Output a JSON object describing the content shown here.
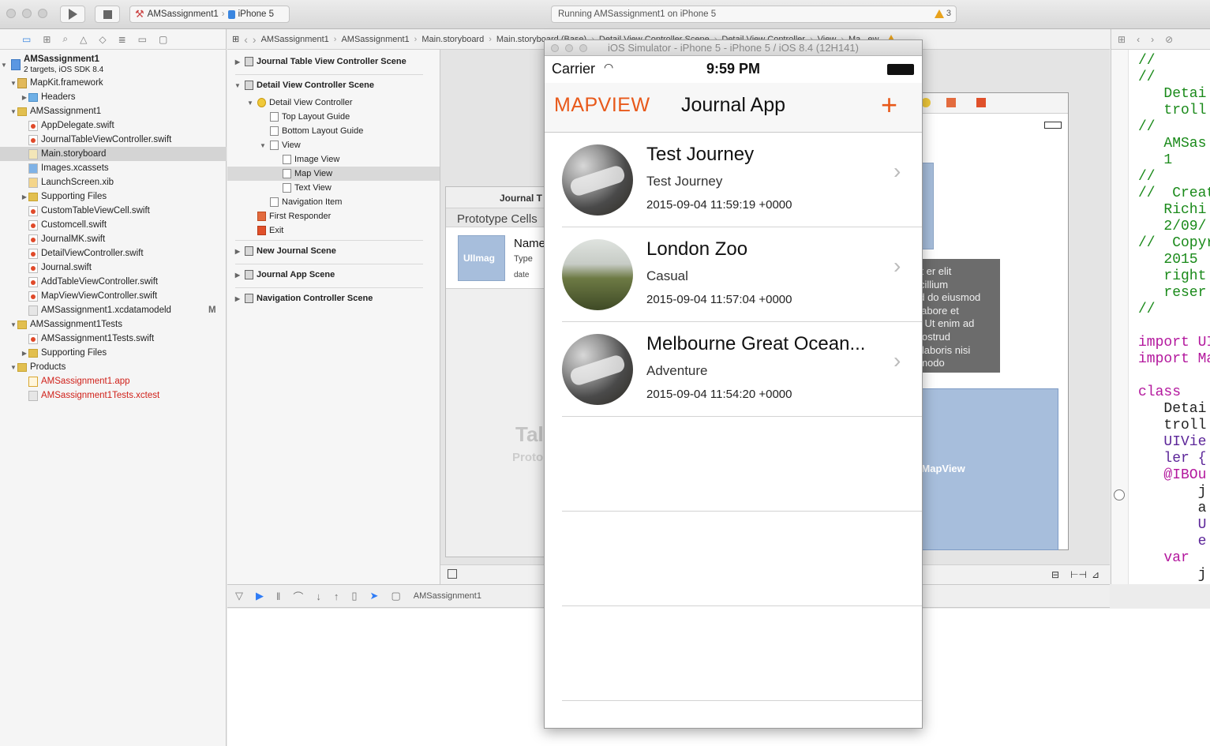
{
  "toolbar": {
    "scheme_app": "AMSassignment1",
    "scheme_device": "iPhone 5",
    "activity": "Running AMSassignment1 on iPhone 5",
    "warning_count": "3"
  },
  "navigator": {
    "project": {
      "name": "AMSassignment1",
      "subtitle": "2 targets, iOS SDK 8.4"
    },
    "items": [
      {
        "label": "MapKit.framework",
        "indent": 1,
        "type": "fw",
        "tri": "▼"
      },
      {
        "label": "Headers",
        "indent": 2,
        "type": "folderblue",
        "tri": "▶"
      },
      {
        "label": "AMSassignment1",
        "indent": 1,
        "type": "folder",
        "tri": "▼"
      },
      {
        "label": "AppDelegate.swift",
        "indent": 2,
        "type": "swift"
      },
      {
        "label": "JournalTableViewController.swift",
        "indent": 2,
        "type": "swift"
      },
      {
        "label": "Main.storyboard",
        "indent": 2,
        "type": "sb",
        "selected": true
      },
      {
        "label": "Images.xcassets",
        "indent": 2,
        "type": "xcassets"
      },
      {
        "label": "LaunchScreen.xib",
        "indent": 2,
        "type": "xib"
      },
      {
        "label": "Supporting Files",
        "indent": 2,
        "type": "folder",
        "tri": "▶"
      },
      {
        "label": "CustomTableViewCell.swift",
        "indent": 2,
        "type": "swift"
      },
      {
        "label": "Customcell.swift",
        "indent": 2,
        "type": "swift"
      },
      {
        "label": "JournalMK.swift",
        "indent": 2,
        "type": "swift"
      },
      {
        "label": "DetailViewController.swift",
        "indent": 2,
        "type": "swift"
      },
      {
        "label": "Journal.swift",
        "indent": 2,
        "type": "swift"
      },
      {
        "label": "AddTableViewController.swift",
        "indent": 2,
        "type": "swift"
      },
      {
        "label": "MapViewViewController.swift",
        "indent": 2,
        "type": "swift"
      },
      {
        "label": "AMSassignment1.xcdatamodeld",
        "indent": 2,
        "type": "model",
        "badge": "M"
      },
      {
        "label": "AMSassignment1Tests",
        "indent": 1,
        "type": "folder",
        "tri": "▼"
      },
      {
        "label": "AMSassignment1Tests.swift",
        "indent": 2,
        "type": "swift"
      },
      {
        "label": "Supporting Files",
        "indent": 2,
        "type": "folder",
        "tri": "▶"
      },
      {
        "label": "Products",
        "indent": 1,
        "type": "folder",
        "tri": "▼"
      },
      {
        "label": "AMSassignment1.app",
        "indent": 2,
        "type": "app",
        "red": true
      },
      {
        "label": "AMSassignment1Tests.xctest",
        "indent": 2,
        "type": "model",
        "red": true
      }
    ]
  },
  "jumpbar": {
    "items": [
      "AMSassignment1",
      "AMSassignment1",
      "Main.storyboard",
      "Main.storyboard (Base)",
      "Detail View Controller Scene",
      "Detail View Controller",
      "View",
      "Ma...ew"
    ]
  },
  "outline": {
    "rows": [
      {
        "label": "Journal Table View Controller Scene",
        "indent": 0,
        "tri": "▶",
        "bold": true,
        "icon": "scene"
      },
      {
        "label": "Detail View Controller Scene",
        "indent": 0,
        "tri": "▼",
        "bold": true,
        "icon": "scene"
      },
      {
        "label": "Detail View Controller",
        "indent": 1,
        "tri": "▼",
        "icon": "vc"
      },
      {
        "label": "Top Layout Guide",
        "indent": 2,
        "icon": "box"
      },
      {
        "label": "Bottom Layout Guide",
        "indent": 2,
        "icon": "box"
      },
      {
        "label": "View",
        "indent": 2,
        "tri": "▼",
        "icon": "box"
      },
      {
        "label": "Image View",
        "indent": 3,
        "icon": "box"
      },
      {
        "label": "Map View",
        "indent": 3,
        "icon": "box",
        "selected": true
      },
      {
        "label": "Text View",
        "indent": 3,
        "icon": "box"
      },
      {
        "label": "Navigation Item",
        "indent": 2,
        "icon": "box"
      },
      {
        "label": "First Responder",
        "indent": 1,
        "icon": "fr"
      },
      {
        "label": "Exit",
        "indent": 1,
        "icon": "exit"
      },
      {
        "label": "New Journal Scene",
        "indent": 0,
        "tri": "▶",
        "bold": true,
        "icon": "scene"
      },
      {
        "label": "Journal App Scene",
        "indent": 0,
        "tri": "▶",
        "bold": true,
        "icon": "scene"
      },
      {
        "label": "Navigation Controller Scene",
        "indent": 0,
        "tri": "▶",
        "bold": true,
        "icon": "scene"
      }
    ]
  },
  "canvas": {
    "table_scene_title": "Journal T",
    "prototype_cells": "Prototype Cells",
    "proto_image": "UIImag",
    "proto_name": "Name",
    "proto_type": "Type",
    "proto_date": "date",
    "table_label": "Tal",
    "proto_label": "Proto",
    "lorem": "sit er elit\nr cillium\ned do eiusmod\nt labore et\na. Ut enim ad\n nostrud\no laboris nisi\nnmodo",
    "mapview_label": "KMapView"
  },
  "debug": {
    "target": "AMSassignment1"
  },
  "editor": {
    "lines": [
      {
        "t": "//",
        "c": "comment"
      },
      {
        "t": "//",
        "c": "comment"
      },
      {
        "t": "   Detai",
        "c": "comment"
      },
      {
        "t": "   troll",
        "c": "comment"
      },
      {
        "t": "//",
        "c": "comment"
      },
      {
        "t": "   AMSas",
        "c": "comment"
      },
      {
        "t": "   1",
        "c": "comment"
      },
      {
        "t": "//",
        "c": "comment"
      },
      {
        "t": "//  Creat",
        "c": "comment"
      },
      {
        "t": "   Richi",
        "c": "comment"
      },
      {
        "t": "   2/09/",
        "c": "comment"
      },
      {
        "t": "//  Copyr",
        "c": "comment"
      },
      {
        "t": "   2015",
        "c": "comment"
      },
      {
        "t": "   right",
        "c": "comment"
      },
      {
        "t": "   reser",
        "c": "comment"
      },
      {
        "t": "//",
        "c": "comment"
      },
      {
        "t": "",
        "c": "plain"
      },
      {
        "t": "import UI",
        "c": "kw"
      },
      {
        "t": "import Ma",
        "c": "kw"
      },
      {
        "t": "",
        "c": "plain"
      },
      {
        "t": "class",
        "c": "kw"
      },
      {
        "t": "   Detai",
        "c": "plain"
      },
      {
        "t": "   troll",
        "c": "plain"
      },
      {
        "t": "   UIVie",
        "c": "type"
      },
      {
        "t": "   ler {",
        "c": "type"
      },
      {
        "t": "   @IBOu",
        "c": "kw"
      },
      {
        "t": "       j",
        "c": "plain"
      },
      {
        "t": "       a",
        "c": "plain"
      },
      {
        "t": "       U",
        "c": "type"
      },
      {
        "t": "       e",
        "c": "type"
      },
      {
        "t": "   var",
        "c": "kw"
      },
      {
        "t": "       j",
        "c": "plain"
      }
    ]
  },
  "simulator": {
    "title": "iOS Simulator - iPhone 5 - iPhone 5 / iOS 8.4 (12H141)",
    "carrier": "Carrier",
    "time": "9:59 PM",
    "nav_left": "MAPVIEW",
    "nav_title": "Journal App",
    "nav_add": "+",
    "rows": [
      {
        "title": "Test Journey",
        "subtitle": "Test Journey",
        "date": "2015-09-04 11:59:19 +0000",
        "thumb": "water"
      },
      {
        "title": "London Zoo",
        "subtitle": "Casual",
        "date": "2015-09-04 11:57:04 +0000",
        "thumb": "grass"
      },
      {
        "title": "Melbourne Great Ocean...",
        "subtitle": "Adventure",
        "date": "2015-09-04 11:54:20 +0000",
        "thumb": "water"
      }
    ]
  },
  "colors": {
    "accent": "#e8591a",
    "selection": "#d4d4d4",
    "mapview_fill": "#a7bedc",
    "warning": "#e8a21c"
  }
}
